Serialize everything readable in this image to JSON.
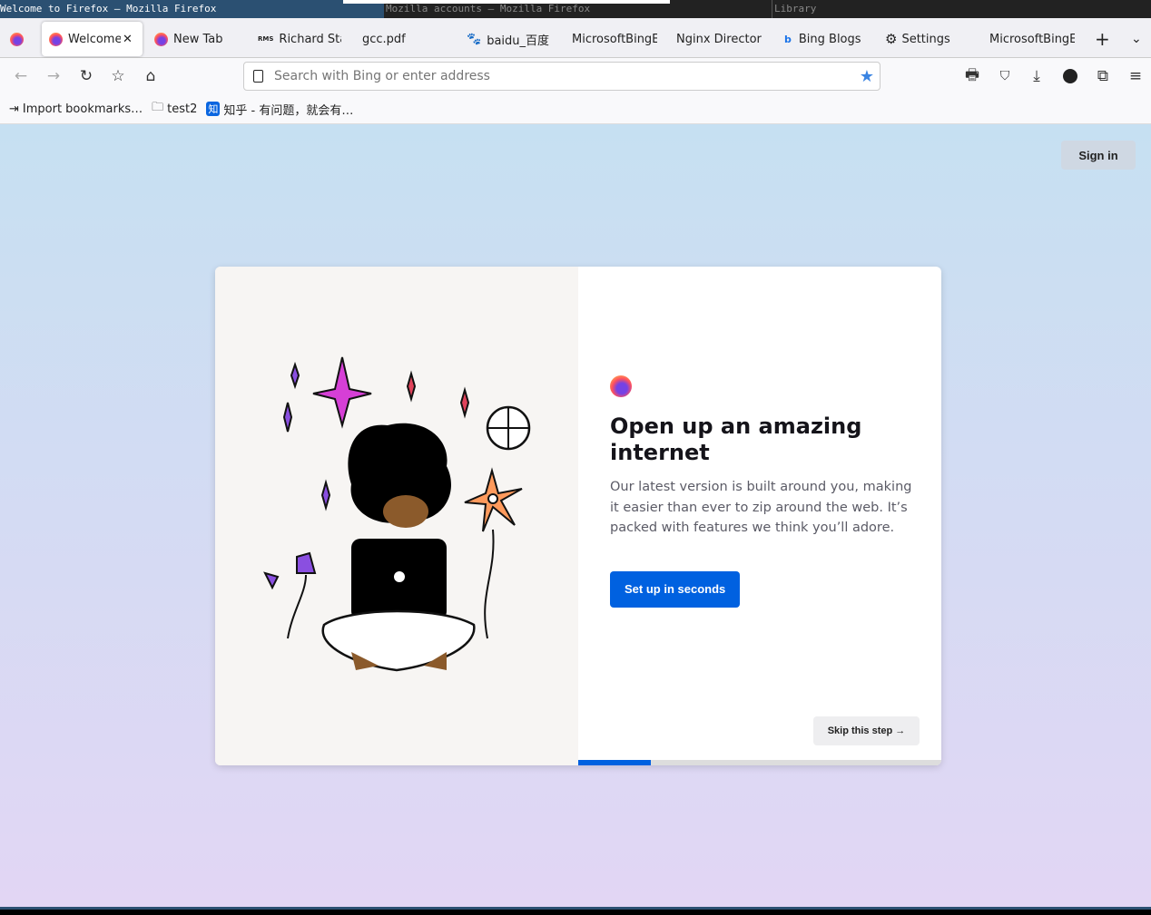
{
  "wm": {
    "windows": [
      "Welcome to Firefox — Mozilla Firefox",
      "Mozilla accounts — Mozilla Firefox",
      "Library"
    ]
  },
  "tabs": [
    {
      "label": "Welcome",
      "icon": "firefox-icon",
      "selected": true
    },
    {
      "label": "New Tab",
      "icon": "firefox-icon"
    },
    {
      "label": "Richard Sta",
      "icon": "rms-icon",
      "icon_text": "RMS"
    },
    {
      "label": "gcc.pdf"
    },
    {
      "label": "baidu_百度",
      "icon": "baidu-icon"
    },
    {
      "label": "MicrosoftBingE"
    },
    {
      "label": "Nginx Directory"
    },
    {
      "label": "Bing Blogs",
      "icon": "bing-icon"
    },
    {
      "label": "Settings",
      "icon": "gear-icon"
    },
    {
      "label": "MicrosoftBingE"
    }
  ],
  "urlbar": {
    "placeholder": "Search with Bing or enter address"
  },
  "bookmarks": [
    {
      "label": "Import bookmarks…"
    },
    {
      "label": "test2"
    },
    {
      "label": "知乎 - 有问题，就会有…",
      "icon_text": "知"
    }
  ],
  "page": {
    "sign_in": "Sign in",
    "title": "Open up an amazing internet",
    "description": "Our latest version is built around you, making it easier than ever to zip around the web. It’s packed with features we think you’ll adore.",
    "primary_button": "Set up in seconds",
    "skip_button": "Skip this step",
    "progress_percent": 20
  },
  "colors": {
    "accent": "#0061e0",
    "bookmark_star": "#3a84e2"
  }
}
